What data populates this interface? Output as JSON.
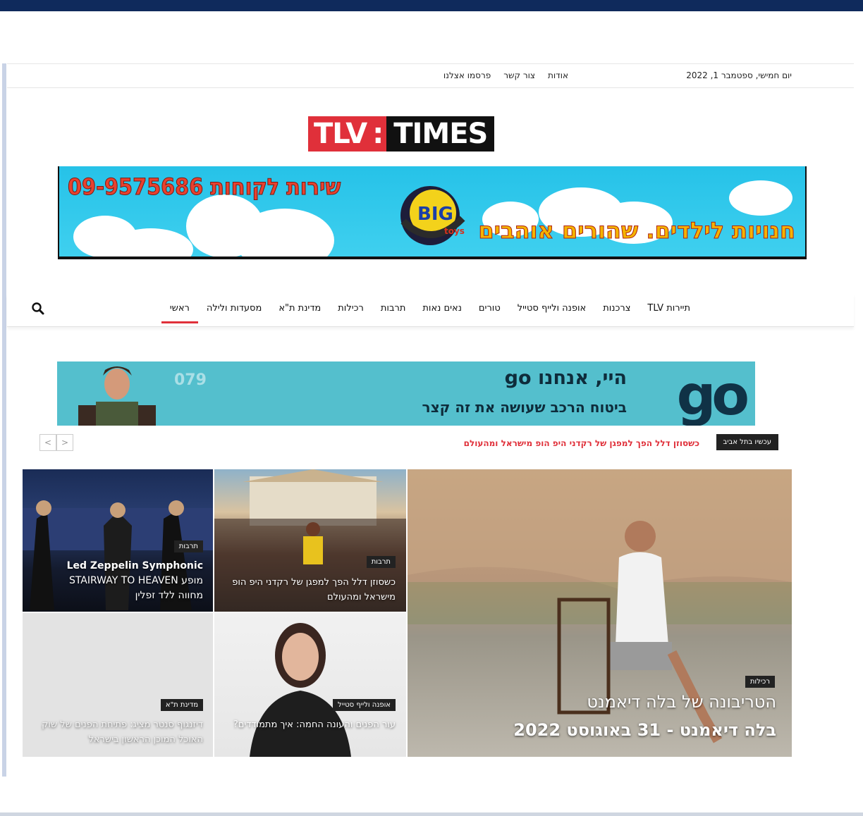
{
  "utility": {
    "date": "יום חמישי, ספטמבר 1, 2022",
    "links": [
      "אודות",
      "צור קשר",
      "פרסמו אצלנו"
    ]
  },
  "logo": {
    "left": "TLV",
    "sep": ":",
    "right": "TIMES"
  },
  "banner_top": {
    "phone": "שירות לקוחות 09-9575686",
    "slogan": "חנויות לילדים. שהורים אוהבים",
    "brand": "BIG toys"
  },
  "nav": {
    "items": [
      "ראשי",
      "מסעדות ולילה",
      "מדינת ת\"א",
      "רכילות",
      "תרבות",
      "נאים נאות",
      "טורים",
      "אופנה ולייף סטייל",
      "צרכנות",
      "תיירות TLV"
    ],
    "active_index": 0
  },
  "banner_ad": {
    "brand": "go",
    "headline": "היי, אנחנו go",
    "subline": "ביטוח הרכב שעושה את זה קצר",
    "number": "079"
  },
  "ticker": {
    "label": "עכשיו בתל אביב",
    "text": "כשסוזן דלל הפך למפגן של רקדני היפ הופ מישראל ומהעולם",
    "prev": "<",
    "next": ">"
  },
  "tiles": {
    "main": {
      "category": "רכילות",
      "title_line1": "הטריבונה של בלה דיאמנט",
      "title_line2": "בלה דיאמנט - 31 באוגוסט 2022"
    },
    "dance": {
      "category": "תרבות",
      "title": "כשסוזן דלל הפך למפגן של רקדני היפ הופ מישראל ומהעולם"
    },
    "concert": {
      "category": "תרבות",
      "title_line1": "Led Zeppelin Symphonic",
      "title_line2": "מופע STAIRWAY TO HEAVEN",
      "title_line3": "מחווה ללד זפלין"
    },
    "woman": {
      "category": "אופנה ולייף סטייל",
      "title": "עור הפנים והעונה החמה: איך מתמודדים?"
    },
    "gray": {
      "category": "מדינת ת\"א",
      "title": "דיזנגוף סנטר מציג: פתיחת הפנים של שוק האוכל המוכן הראשון בישראל"
    }
  },
  "colors": {
    "accent": "#e0303a",
    "top_bar": "#0f2a5c",
    "ad_bg": "#54bfcd",
    "banner_sky": "#26c2e8"
  }
}
